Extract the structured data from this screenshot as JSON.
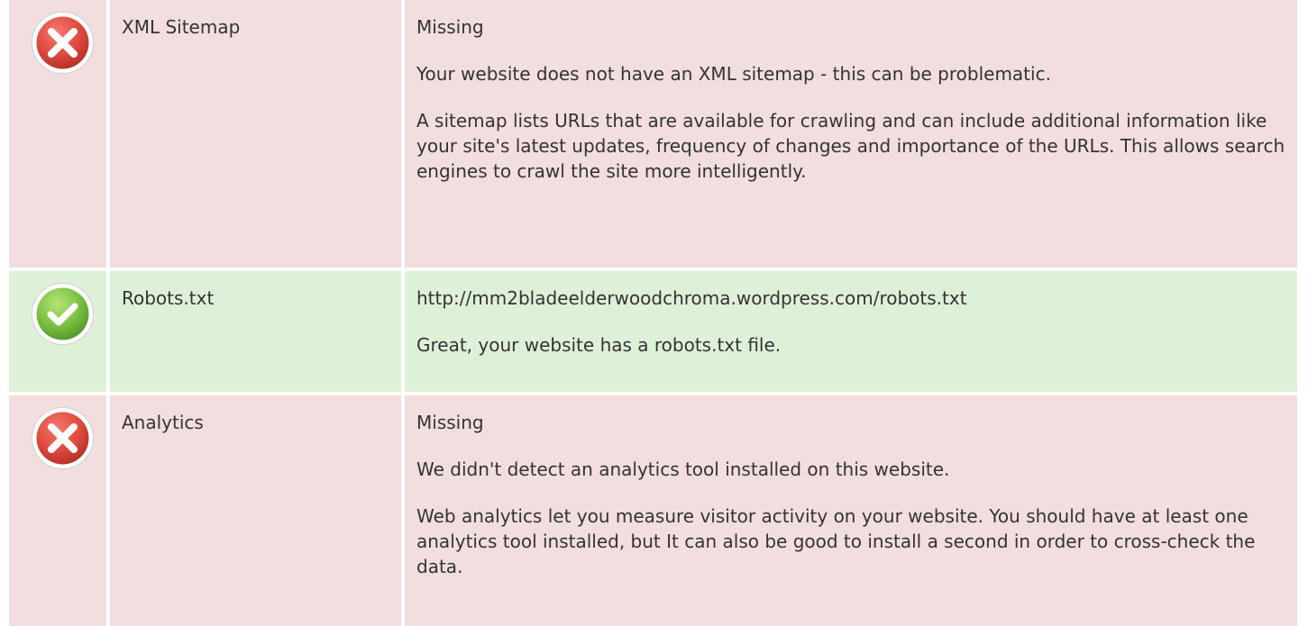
{
  "rows": [
    {
      "status": "fail",
      "status_icon": "error-icon",
      "name": "XML Sitemap",
      "value": "Missing",
      "summary": "Your website does not have an XML sitemap - this can be problematic.",
      "description": "A sitemap lists URLs that are available for crawling and can include additional information like your site's latest updates, frequency of changes and importance of the URLs. This allows search engines to crawl the site more intelligently."
    },
    {
      "status": "pass",
      "status_icon": "check-icon",
      "name": "Robots.txt",
      "value": "http://mm2bladeelderwoodchroma.wordpress.com/robots.txt",
      "summary": "Great, your website has a robots.txt file."
    },
    {
      "status": "fail",
      "status_icon": "error-icon",
      "name": "Analytics",
      "value": "Missing",
      "summary": "We didn't detect an analytics tool installed on this website.",
      "description": "Web analytics let you measure visitor activity on your website. You should have at least one analytics tool installed, but It can also be good to install a second in order to cross-check the data."
    }
  ],
  "colors": {
    "fail_bg": "#f2dede",
    "pass_bg": "#dff0d8",
    "error_red": "#d9534f",
    "success_green": "#7cc242",
    "text": "#333333"
  }
}
